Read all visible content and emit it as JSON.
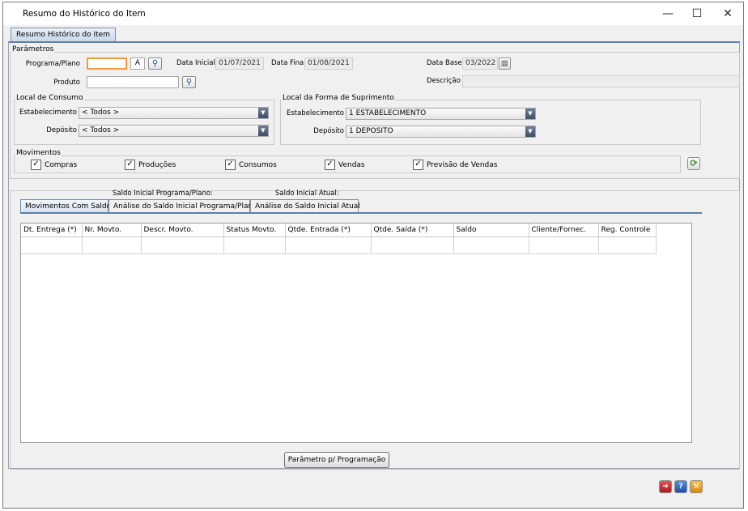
{
  "window": {
    "title": "Resumo do Histórico do Item",
    "minimize_glyph": "—",
    "maximize_glyph": "☐",
    "close_glyph": "✕"
  },
  "main_tab": {
    "label": "Resumo Histórico do Item"
  },
  "parametros": {
    "title": "Parâmetros",
    "programa_label": "Programa/Plano",
    "programa_value": "",
    "programa_suffix": "A",
    "data_inicial_label": "Data Inicial",
    "data_inicial_value": "01/07/2021",
    "data_final_label": "Data Final",
    "data_final_value": "01/08/2021",
    "data_base_label": "Data Base",
    "data_base_value": "03/2022",
    "produto_label": "Produto",
    "produto_value": "",
    "descricao_label": "Descrição",
    "descricao_value": ""
  },
  "local_consumo": {
    "title": "Local de Consumo",
    "estabelecimento_label": "Estabelecimento",
    "estabelecimento_value": "< Todos >",
    "deposito_label": "Depósito",
    "deposito_value": "< Todos >"
  },
  "local_suprimento": {
    "title": "Local da Forma de Suprimento",
    "estabelecimento_label": "Estabelecimento",
    "estabelecimento_value": "1 ESTABELECIMENTO",
    "deposito_label": "Depósito",
    "deposito_value": "1 DEPOSITO"
  },
  "movimentos": {
    "title": "Movimentos",
    "items": [
      {
        "label": "Compras",
        "checked": true
      },
      {
        "label": "Produções",
        "checked": true
      },
      {
        "label": "Consumos",
        "checked": true
      },
      {
        "label": "Vendas",
        "checked": true
      },
      {
        "label": "Previsão de Vendas",
        "checked": true
      }
    ]
  },
  "saldo": {
    "programa_label": "Saldo Inicial Programa/Plano:",
    "atual_label": "Saldo Inicial Atual:"
  },
  "tabs": [
    {
      "label": "Movimentos Com Saldo",
      "active": true
    },
    {
      "label": "Análise do Saldo Inicial Programa/Plano",
      "active": false
    },
    {
      "label": "Análise do Saldo Inicial Atual",
      "active": false
    }
  ],
  "table": {
    "columns": [
      "Dt. Entrega (*)",
      "Nr. Movto.",
      "Descr. Movto.",
      "Status Movto.",
      "Qtde. Entrada (*)",
      "Qtde. Saída (*)",
      "Saldo",
      "Cliente/Fornec.",
      "Reg. Controle"
    ],
    "rows": []
  },
  "buttons": {
    "parametro_programacao": "Parâmetro p/ Programação"
  },
  "colors": {
    "accent": "#5d7fa6",
    "focus": "#f39c3c"
  }
}
